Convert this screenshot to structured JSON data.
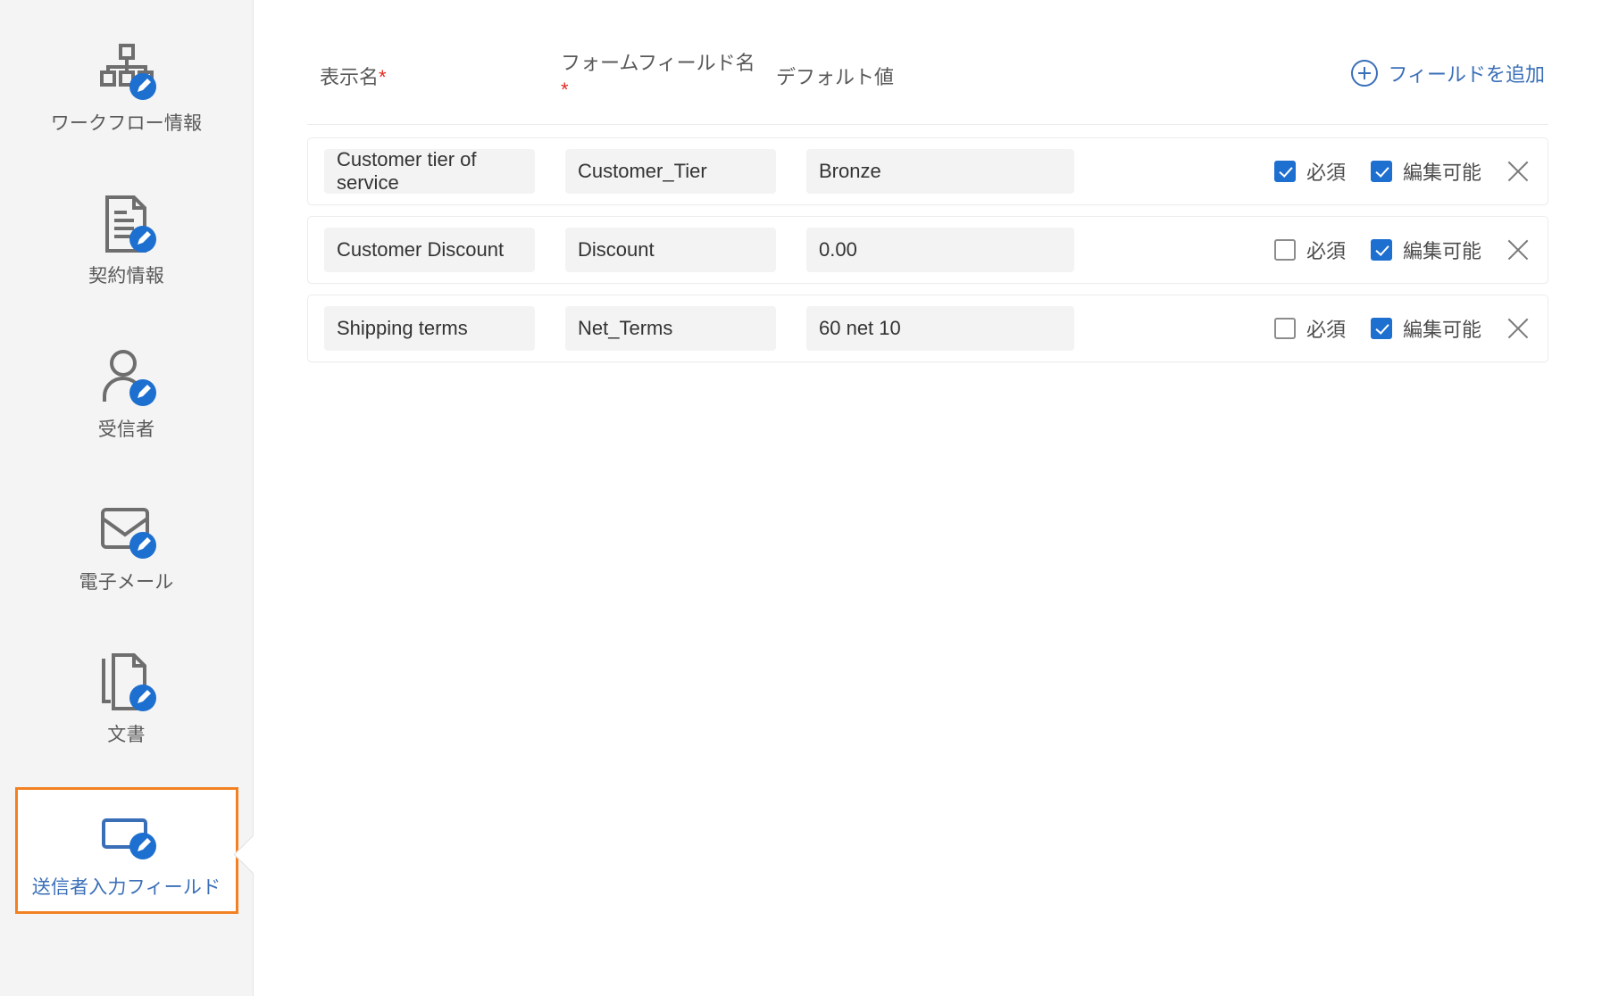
{
  "sidebar": {
    "items": [
      {
        "label": "ワークフロー情報",
        "icon": "workflow-info-icon",
        "selected": false
      },
      {
        "label": "契約情報",
        "icon": "agreement-info-icon",
        "selected": false
      },
      {
        "label": "受信者",
        "icon": "recipients-icon",
        "selected": false
      },
      {
        "label": "電子メール",
        "icon": "email-icon",
        "selected": false
      },
      {
        "label": "文書",
        "icon": "documents-icon",
        "selected": false
      },
      {
        "label": "送信者入力フィールド",
        "icon": "sender-input-fields-icon",
        "selected": true
      }
    ],
    "selected_border_color": "#f28122",
    "selected_label_color": "#3a6fb8"
  },
  "table": {
    "headers": {
      "display_name": "表示名",
      "display_name_required_marker": "*",
      "form_field_name": "フォームフィールド名",
      "form_field_name_required_marker": "*",
      "default_value": "デフォルト値"
    },
    "add_field_label": "フィールドを追加",
    "add_field_icon": "plus-circle-icon",
    "labels": {
      "required": "必須",
      "editable": "編集可能",
      "remove_icon": "close-icon"
    },
    "rows": [
      {
        "display_name": "Customer tier of service",
        "form_field_name": "Customer_Tier",
        "default_value": "Bronze",
        "required": true,
        "editable": true
      },
      {
        "display_name": "Customer Discount",
        "form_field_name": "Discount",
        "default_value": "0.00",
        "required": false,
        "editable": true
      },
      {
        "display_name": "Shipping terms",
        "form_field_name": "Net_Terms",
        "default_value": "60 net 10",
        "required": false,
        "editable": true
      }
    ]
  },
  "colors": {
    "accent_blue": "#1d6fd0",
    "link_blue": "#3a6fb8",
    "selection_orange": "#f28122",
    "required_red": "#e02b20",
    "sidebar_bg": "#f4f4f4",
    "input_bg": "#f3f3f3"
  }
}
